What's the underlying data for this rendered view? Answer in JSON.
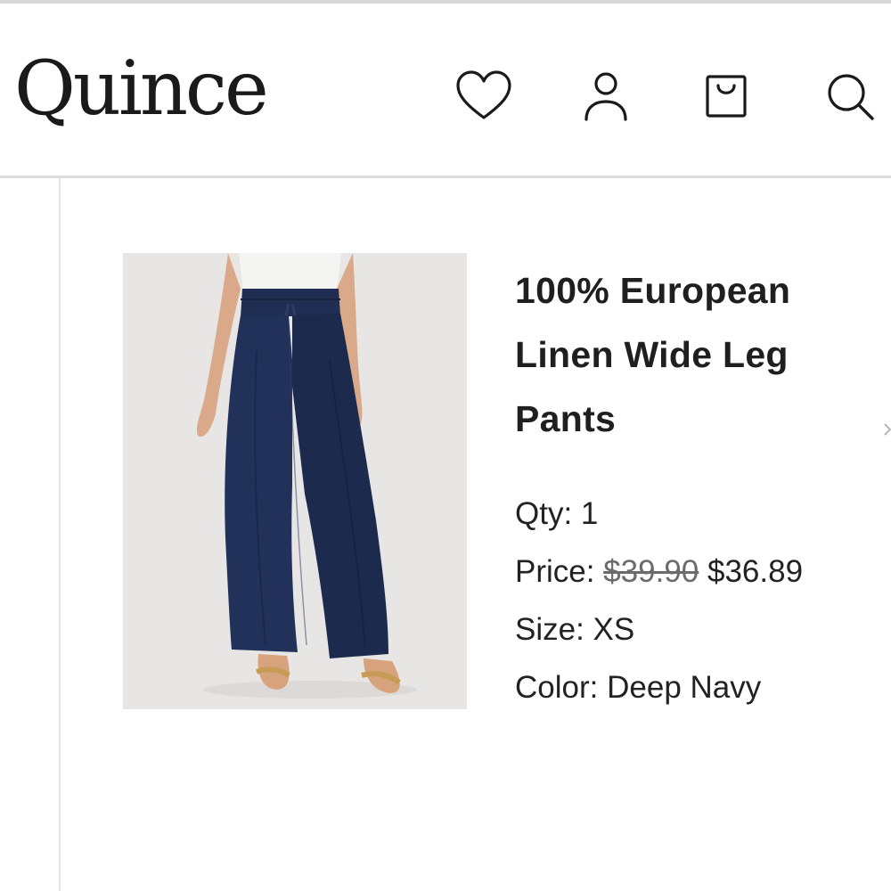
{
  "header": {
    "logo_text": "Quince",
    "icons": {
      "wishlist": "heart-icon",
      "account": "account-icon",
      "bag": "shopping-bag-icon",
      "search": "search-icon"
    }
  },
  "product": {
    "image_description_icon": "product-photo",
    "title": "100% European Linen Wide Leg Pants",
    "qty_label": "Qty:",
    "qty_value": "1",
    "price_label": "Price:",
    "price_original": "$39.90",
    "price_sale": "$36.89",
    "size_label": "Size:",
    "size_value": "XS",
    "color_label": "Color:",
    "color_value": "Deep Navy",
    "color_hex": "#1c2a4a"
  },
  "colors": {
    "text": "#1f1f1f",
    "divider": "#dcdcdc",
    "image_bg": "#e8e6e4"
  }
}
